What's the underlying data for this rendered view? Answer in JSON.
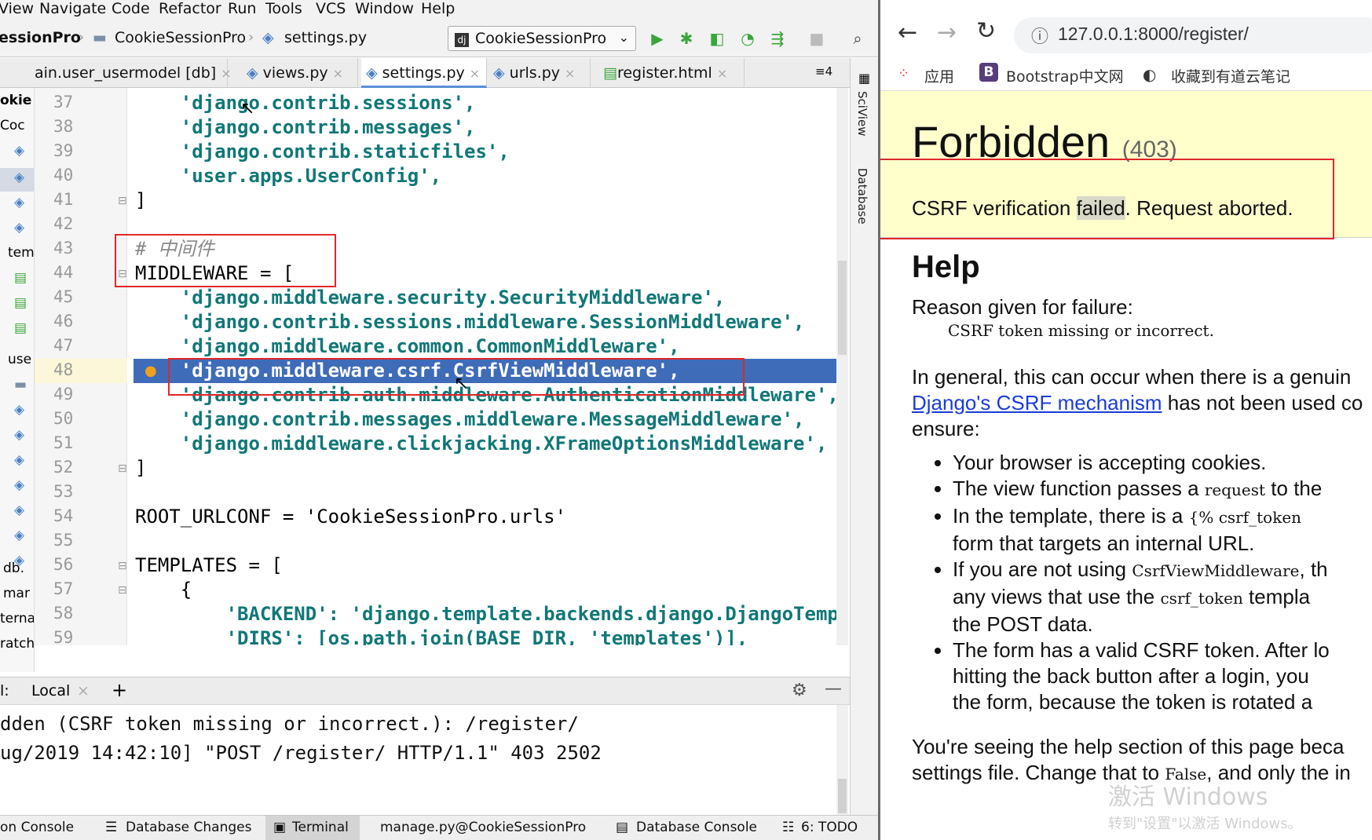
{
  "ide": {
    "menu": [
      "View",
      "Navigate",
      "Code",
      "Refactor",
      "Run",
      "Tools",
      "VCS",
      "Window",
      "Help"
    ],
    "breadcrumb": {
      "project": "essionPro",
      "folder": "CookieSessionPro",
      "file": "settings.py"
    },
    "run_config": "CookieSessionPro",
    "tabs": [
      "ain.user_usermodel [db]",
      "views.py",
      "settings.py",
      "urls.py",
      "register.html"
    ],
    "tab_count": "≡4",
    "project_panel": [
      "okie",
      "Coc",
      "tem",
      "use",
      "db.",
      "mar",
      "terna",
      "ratch"
    ],
    "sidebar_right": [
      "SciView",
      "Database"
    ],
    "line_numbers": [
      "37",
      "38",
      "39",
      "40",
      "41",
      "42",
      "43",
      "44",
      "45",
      "46",
      "47",
      "48",
      "49",
      "50",
      "51",
      "52",
      "53",
      "54",
      "55",
      "56",
      "57",
      "58",
      "59"
    ],
    "code_lines": [
      "    'django.contrib.sessions',",
      "    'django.contrib.messages',",
      "    'django.contrib.staticfiles',",
      "    'user.apps.UserConfig',",
      "]",
      "",
      "# 中间件",
      "MIDDLEWARE = [",
      "    'django.middleware.security.SecurityMiddleware',",
      "    'django.contrib.sessions.middleware.SessionMiddleware',",
      "    'django.middleware.common.CommonMiddleware',",
      "    'django.middleware.csrf.CsrfViewMiddleware',",
      "    'django.contrib.auth.middleware.AuthenticationMiddleware',",
      "    'django.contrib.messages.middleware.MessageMiddleware',",
      "    'django.middleware.clickjacking.XFrameOptionsMiddleware',",
      "]",
      "",
      "ROOT_URLCONF = 'CookieSessionPro.urls'",
      "",
      "TEMPLATES = [",
      "    {",
      "        'BACKEND': 'django.template.backends.django.DjangoTemplates',",
      "        'DIRS': [os.path.join(BASE_DIR, 'templates')],"
    ],
    "terminal": {
      "tab_prefix": "l:",
      "tab_local": "Local",
      "lines": [
        "dden (CSRF token missing or incorrect.): /register/",
        "ug/2019 14:42:10] \"POST /register/ HTTP/1.1\" 403 2502"
      ]
    },
    "statusbar": [
      "on Console",
      "Database Changes",
      "Terminal",
      "manage.py@CookieSessionPro",
      "Database Console",
      "6: TODO"
    ]
  },
  "browser": {
    "url": "127.0.0.1:8000/register/",
    "bookmarks": [
      "应用",
      "Bootstrap中文网",
      "收藏到有道云笔记"
    ],
    "error": {
      "title": "Forbidden",
      "code": "(403)",
      "msg_before": "CSRF verification ",
      "msg_selected": "failed",
      "msg_after": ". Request aborted."
    },
    "help": {
      "heading": "Help",
      "reason_label": "Reason given for failure:",
      "reason": "CSRF token missing or incorrect.",
      "general_1": "In general, this can occur when there is a genuin",
      "general_link": "Django's CSRF mechanism",
      "general_2": " has not been used co",
      "general_3": "ensure:",
      "bullets": [
        {
          "lines": [
            "Your browser is accepting cookies."
          ]
        },
        {
          "lines": [
            "The view function passes a ",
            "request",
            " to the"
          ]
        },
        {
          "lines": [
            "In the template, there is a ",
            "{% csrf_token",
            ""
          ]
        },
        {
          "lines": [
            "form that targets an internal URL."
          ]
        },
        {
          "lines": [
            "If you are not using ",
            "CsrfViewMiddleware",
            ", th"
          ]
        },
        {
          "lines": [
            "any views that use the ",
            "csrf_token",
            " templa"
          ]
        },
        {
          "lines": [
            "the POST data."
          ]
        },
        {
          "lines": [
            "The form has a valid CSRF token. After lo"
          ]
        },
        {
          "lines": [
            "hitting the back button after a login, you"
          ]
        },
        {
          "lines": [
            "the form, because the token is rotated a"
          ]
        }
      ],
      "footer_1": "You're seeing the help section of this page beca",
      "footer_2a": "settings file. Change that to ",
      "footer_2b": "False",
      "footer_2c": ", and only the in"
    },
    "watermark": "激活 Windows",
    "watermark_sub": "转到\"设置\"以激活 Windows。"
  }
}
